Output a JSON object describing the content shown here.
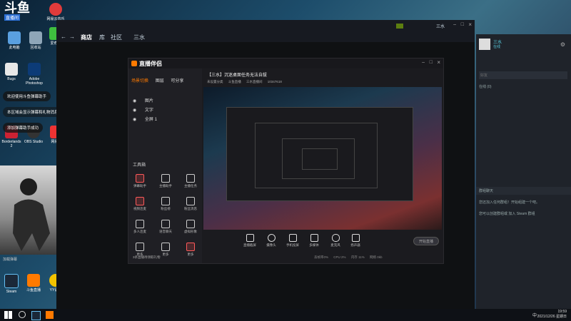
{
  "desktop": {
    "logo": {
      "top": "斗鱼",
      "bottom": "直播间"
    },
    "icons": [
      {
        "label": "此电脑"
      },
      {
        "label": "网易云音乐"
      },
      {
        "label": "爱奇艺"
      },
      {
        "label": "回收站"
      },
      {
        "label": "Bugs"
      },
      {
        "label": "Adobe Photoshop"
      },
      {
        "label": "Borderlands 2"
      },
      {
        "label": "OBS Studio"
      },
      {
        "label": "网易云"
      },
      {
        "label": "Steam"
      },
      {
        "label": "斗鱼直播"
      },
      {
        "label": "YY语音"
      }
    ],
    "chat": [
      "欢迎使用斗鱼弹幕助手",
      "本区域会显示弹幕和礼物消息",
      "添加弹幕助手成功"
    ],
    "webcam_caption": "加载弹幕",
    "colors": {
      "accent": "#ff6a00",
      "steam": "#1b2838"
    }
  },
  "steam": {
    "nav": {
      "store": "商店",
      "library": "库",
      "community": "社区",
      "user": "三水"
    },
    "user_name": "三水"
  },
  "live_app": {
    "title": "直播伴侣",
    "scene_tabs": [
      "场景切换",
      "图层",
      "可分享"
    ],
    "room_title": "【三水】沉迷桌面任务无法自拔",
    "tags": [
      "未设置分类",
      "斗鱼直播",
      "三水直播间"
    ],
    "viewer_count": "10347618",
    "scenes": [
      "图片",
      "文字",
      "全屏 1"
    ],
    "tools_header": "工具箱",
    "tools": [
      {
        "label": "弹幕助手",
        "active": true
      },
      {
        "label": "主播助手"
      },
      {
        "label": "主播任务"
      },
      {
        "label": "视频连麦"
      },
      {
        "label": "粉丝榜"
      },
      {
        "label": "粉丝消息"
      },
      {
        "label": "多人连麦"
      },
      {
        "label": "语音聊天"
      },
      {
        "label": "虚拟形象"
      },
      {
        "label": "更多"
      },
      {
        "label": "更多"
      },
      {
        "label": "更多"
      }
    ],
    "bottom_tools": [
      "直播截屏",
      "摄像头",
      "手机投屏",
      "多媒体",
      "麦克风",
      "扬声器"
    ],
    "start_btn": "开始直播",
    "status_line": "3条直播待领取礼物",
    "stats": [
      "丢帧率0%",
      "CPU 2%",
      "内存 11%",
      "网络 0kb"
    ]
  },
  "friends": {
    "user": "三水",
    "status": "在线",
    "search_placeholder": "好友",
    "online_header": "在线 (0)",
    "group_header": "群组聊天",
    "group_hint": "您还加入任何群组！开始组建一个吧。",
    "group_hint2": "您可以创建群组或 加入 Steam 群组"
  },
  "taskbar": {
    "time": "19:59",
    "date": "2021/12/26 星期日",
    "lang": "中"
  }
}
